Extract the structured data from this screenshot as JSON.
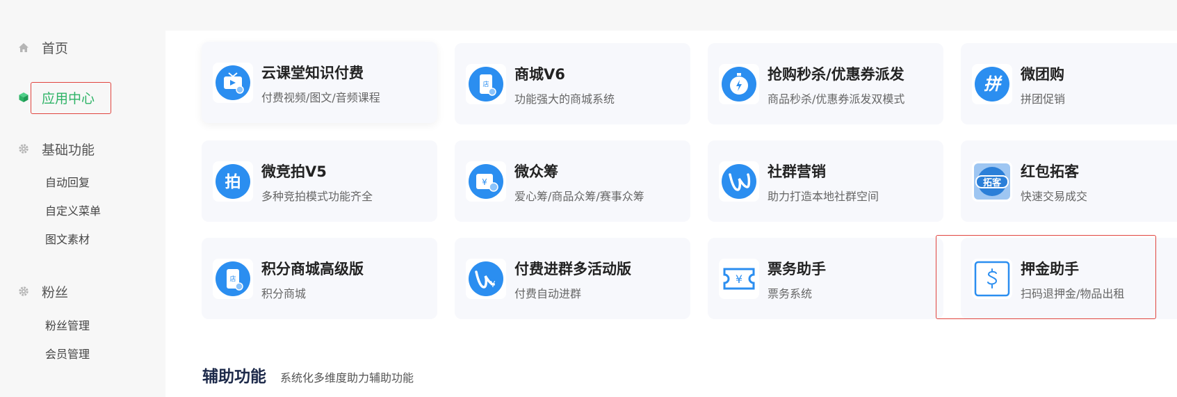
{
  "sidebar": {
    "home": {
      "label": "首页",
      "icon": "home-icon"
    },
    "app_center": {
      "label": "应用中心",
      "icon": "cube-icon"
    },
    "basic": {
      "label": "基础功能",
      "icon": "gear-icon",
      "items": [
        {
          "label": "自动回复"
        },
        {
          "label": "自定义菜单"
        },
        {
          "label": "图文素材"
        }
      ]
    },
    "fans": {
      "label": "粉丝",
      "icon": "gear-icon",
      "items": [
        {
          "label": "粉丝管理"
        },
        {
          "label": "会员管理"
        }
      ]
    }
  },
  "apps": [
    {
      "title": "云课堂知识付费",
      "desc": "付费视频/图文/音频课程",
      "icon": "tv-course-icon"
    },
    {
      "title": "商城V6",
      "desc": "功能强大的商城系统",
      "icon": "shop-phone-icon"
    },
    {
      "title": "抢购秒杀/优惠券派发",
      "desc": "商品秒杀/优惠券派发双模式",
      "icon": "stopwatch-icon"
    },
    {
      "title": "微团购",
      "desc": "拼团促销",
      "icon": "group-buy-icon"
    },
    {
      "title": "微竞拍V5",
      "desc": "多种竞拍模式功能齐全",
      "icon": "auction-icon"
    },
    {
      "title": "微众筹",
      "desc": "爱心筹/商品众筹/赛事众筹",
      "icon": "crowdfunding-icon"
    },
    {
      "title": "社群营销",
      "desc": "助力打造本地社群空间",
      "icon": "community-icon"
    },
    {
      "title": "红包拓客",
      "desc": "快速交易成交",
      "icon": "red-packet-icon"
    },
    {
      "title": "积分商城高级版",
      "desc": "积分商城",
      "icon": "points-shop-icon"
    },
    {
      "title": "付费进群多活动版",
      "desc": "付费自动进群",
      "icon": "paid-group-icon"
    },
    {
      "title": "票务助手",
      "desc": "票务系统",
      "icon": "ticket-icon"
    },
    {
      "title": "押金助手",
      "desc": "扫码退押金/物品出租",
      "icon": "deposit-icon"
    }
  ],
  "section": {
    "title": "辅助功能",
    "subtitle": "系统化多维度助力辅助功能"
  },
  "colors": {
    "accent_green": "#2db366",
    "icon_blue": "#2b8ef0",
    "highlight_red": "#e0443e"
  }
}
